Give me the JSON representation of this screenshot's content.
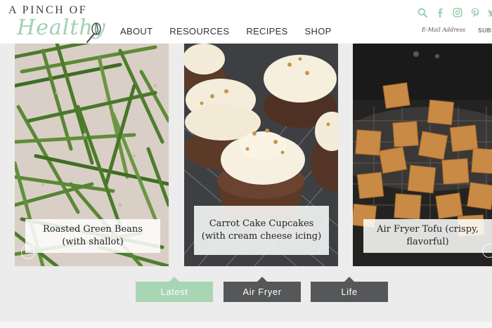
{
  "logo": {
    "top_text": "A PINCH OF",
    "script_text": "Healthy",
    "whisk_icon": "whisk-icon"
  },
  "nav": {
    "items": [
      {
        "label": "ABOUT"
      },
      {
        "label": "RESOURCES"
      },
      {
        "label": "RECIPES"
      },
      {
        "label": "SHOP"
      }
    ]
  },
  "social": {
    "icons": [
      "search-icon",
      "facebook-icon",
      "instagram-icon",
      "pinterest-icon",
      "twitter-icon"
    ],
    "color": "#9fd0b3"
  },
  "subscribe": {
    "email_placeholder": "E-Mail Address",
    "button_label": "SUBS"
  },
  "cards": [
    {
      "title": "Roasted Green Beans (with shallot)"
    },
    {
      "title": "Carrot Cake Cupcakes (with cream cheese icing)"
    },
    {
      "title": "Air Fryer Tofu (crispy, flavorful)"
    }
  ],
  "tabs": [
    {
      "label": "Latest",
      "active": true,
      "color": "#a8d5b4"
    },
    {
      "label": "Air Fryer",
      "active": false,
      "color": "#555759"
    },
    {
      "label": "Life",
      "active": false,
      "color": "#555759"
    }
  ]
}
